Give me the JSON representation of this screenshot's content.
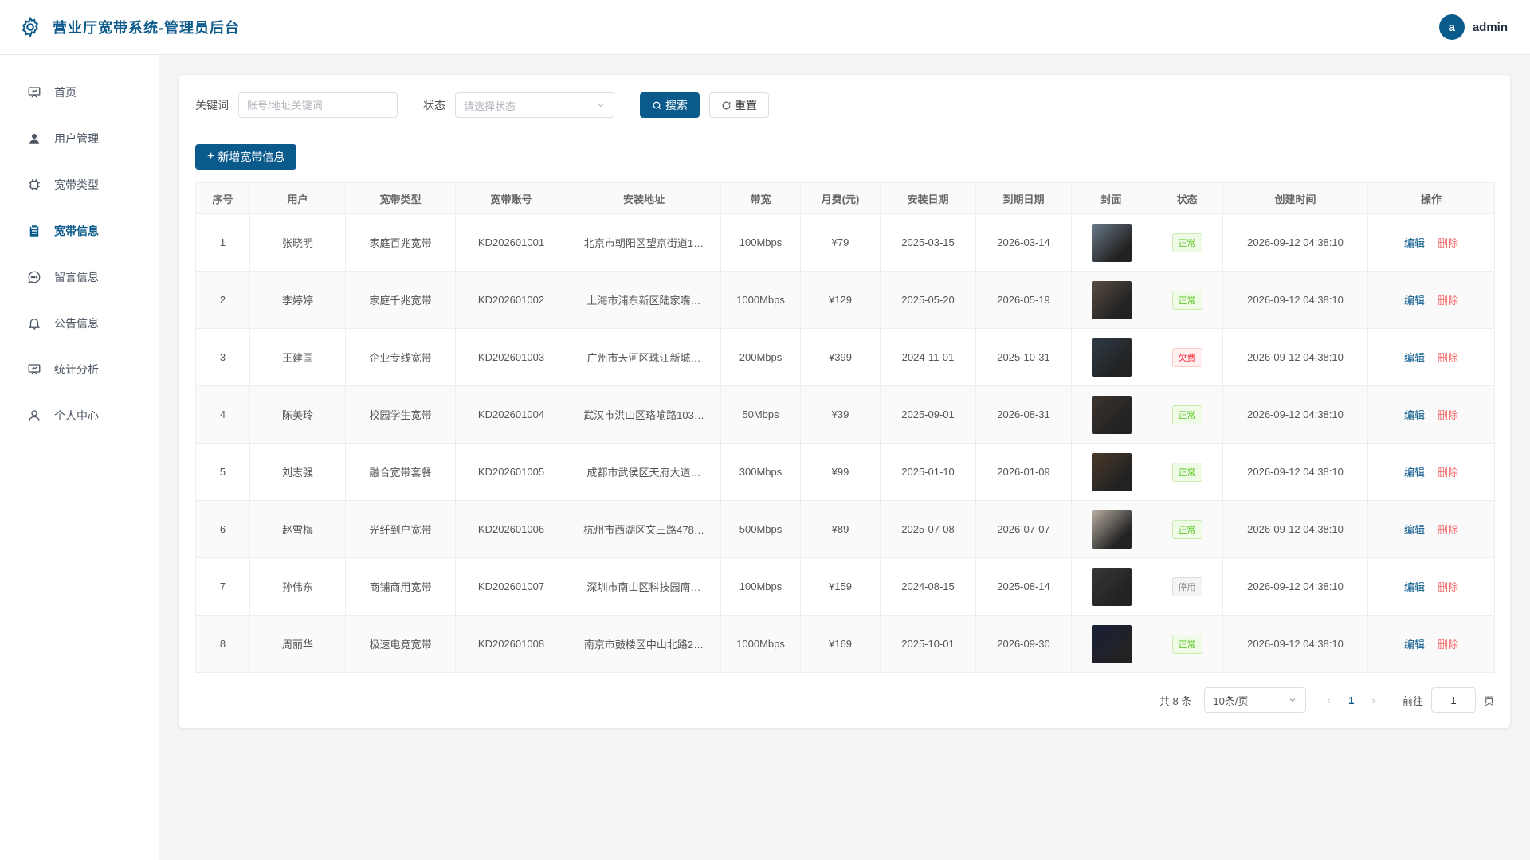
{
  "header": {
    "title": "营业厅宽带系统-管理员后台",
    "avatar_letter": "a",
    "username": "admin"
  },
  "colors": {
    "primary": "#0b5a8c",
    "danger": "#f56c6c",
    "success": "#52c41a"
  },
  "sidebar": {
    "items": [
      {
        "label": "首页",
        "icon": "dashboard-icon",
        "active": false
      },
      {
        "label": "用户管理",
        "icon": "user-icon",
        "active": false
      },
      {
        "label": "宽带类型",
        "icon": "chip-icon",
        "active": false
      },
      {
        "label": "宽带信息",
        "icon": "clipboard-icon",
        "active": true
      },
      {
        "label": "留言信息",
        "icon": "chat-icon",
        "active": false
      },
      {
        "label": "公告信息",
        "icon": "bell-icon",
        "active": false
      },
      {
        "label": "统计分析",
        "icon": "chart-icon",
        "active": false
      },
      {
        "label": "个人中心",
        "icon": "person-icon",
        "active": false
      }
    ]
  },
  "filters": {
    "keyword_label": "关键词",
    "keyword_placeholder": "账号/地址关键词",
    "keyword_value": "",
    "status_label": "状态",
    "status_placeholder": "请选择状态",
    "search_label": "搜索",
    "reset_label": "重置"
  },
  "add_label": "新增宽带信息",
  "table": {
    "columns": [
      "序号",
      "用户",
      "宽带类型",
      "宽带账号",
      "安装地址",
      "带宽",
      "月费(元)",
      "安装日期",
      "到期日期",
      "封面",
      "状态",
      "创建时间",
      "操作"
    ],
    "edit_label": "编辑",
    "delete_label": "删除",
    "rows": [
      {
        "no": "1",
        "user": "张晓明",
        "type": "家庭百兆宽带",
        "account": "KD202601001",
        "address": "北京市朝阳区望京街道1…",
        "bandwidth": "100Mbps",
        "fee": "¥79",
        "install": "2025-03-15",
        "expire": "2026-03-14",
        "status": "正常",
        "status_kind": "ok",
        "created": "2026-09-12 04:38:10",
        "cover": "#6b7a8a"
      },
      {
        "no": "2",
        "user": "李婷婷",
        "type": "家庭千兆宽带",
        "account": "KD202601002",
        "address": "上海市浦东新区陆家嘴…",
        "bandwidth": "1000Mbps",
        "fee": "¥129",
        "install": "2025-05-20",
        "expire": "2026-05-19",
        "status": "正常",
        "status_kind": "ok",
        "created": "2026-09-12 04:38:10",
        "cover": "#5a4d42"
      },
      {
        "no": "3",
        "user": "王建国",
        "type": "企业专线宽带",
        "account": "KD202601003",
        "address": "广州市天河区珠江新城…",
        "bandwidth": "200Mbps",
        "fee": "¥399",
        "install": "2024-11-01",
        "expire": "2025-10-31",
        "status": "欠费",
        "status_kind": "owe",
        "created": "2026-09-12 04:38:10",
        "cover": "#2f3b47"
      },
      {
        "no": "4",
        "user": "陈美玲",
        "type": "校园学生宽带",
        "account": "KD202601004",
        "address": "武汉市洪山区珞喻路103…",
        "bandwidth": "50Mbps",
        "fee": "¥39",
        "install": "2025-09-01",
        "expire": "2026-08-31",
        "status": "正常",
        "status_kind": "ok",
        "created": "2026-09-12 04:38:10",
        "cover": "#3d3530"
      },
      {
        "no": "5",
        "user": "刘志强",
        "type": "融合宽带套餐",
        "account": "KD202601005",
        "address": "成都市武侯区天府大道…",
        "bandwidth": "300Mbps",
        "fee": "¥99",
        "install": "2025-01-10",
        "expire": "2026-01-09",
        "status": "正常",
        "status_kind": "ok",
        "created": "2026-09-12 04:38:10",
        "cover": "#4a3a2a"
      },
      {
        "no": "6",
        "user": "赵雪梅",
        "type": "光纤到户宽带",
        "account": "KD202601006",
        "address": "杭州市西湖区文三路478…",
        "bandwidth": "500Mbps",
        "fee": "¥89",
        "install": "2025-07-08",
        "expire": "2026-07-07",
        "status": "正常",
        "status_kind": "ok",
        "created": "2026-09-12 04:38:10",
        "cover": "#b8aea2"
      },
      {
        "no": "7",
        "user": "孙伟东",
        "type": "商铺商用宽带",
        "account": "KD202601007",
        "address": "深圳市南山区科技园南…",
        "bandwidth": "100Mbps",
        "fee": "¥159",
        "install": "2024-08-15",
        "expire": "2025-08-14",
        "status": "停用",
        "status_kind": "stop",
        "created": "2026-09-12 04:38:10",
        "cover": "#383838"
      },
      {
        "no": "8",
        "user": "周丽华",
        "type": "极速电竞宽带",
        "account": "KD202601008",
        "address": "南京市鼓楼区中山北路2…",
        "bandwidth": "1000Mbps",
        "fee": "¥169",
        "install": "2025-10-01",
        "expire": "2026-09-30",
        "status": "正常",
        "status_kind": "ok",
        "created": "2026-09-12 04:38:10",
        "cover": "#1a1f3a"
      }
    ]
  },
  "pagination": {
    "total_text": "共 8 条",
    "page_size": "10条/页",
    "current_page": "1",
    "goto_label": "前往",
    "goto_value": "1",
    "page_suffix": "页"
  }
}
